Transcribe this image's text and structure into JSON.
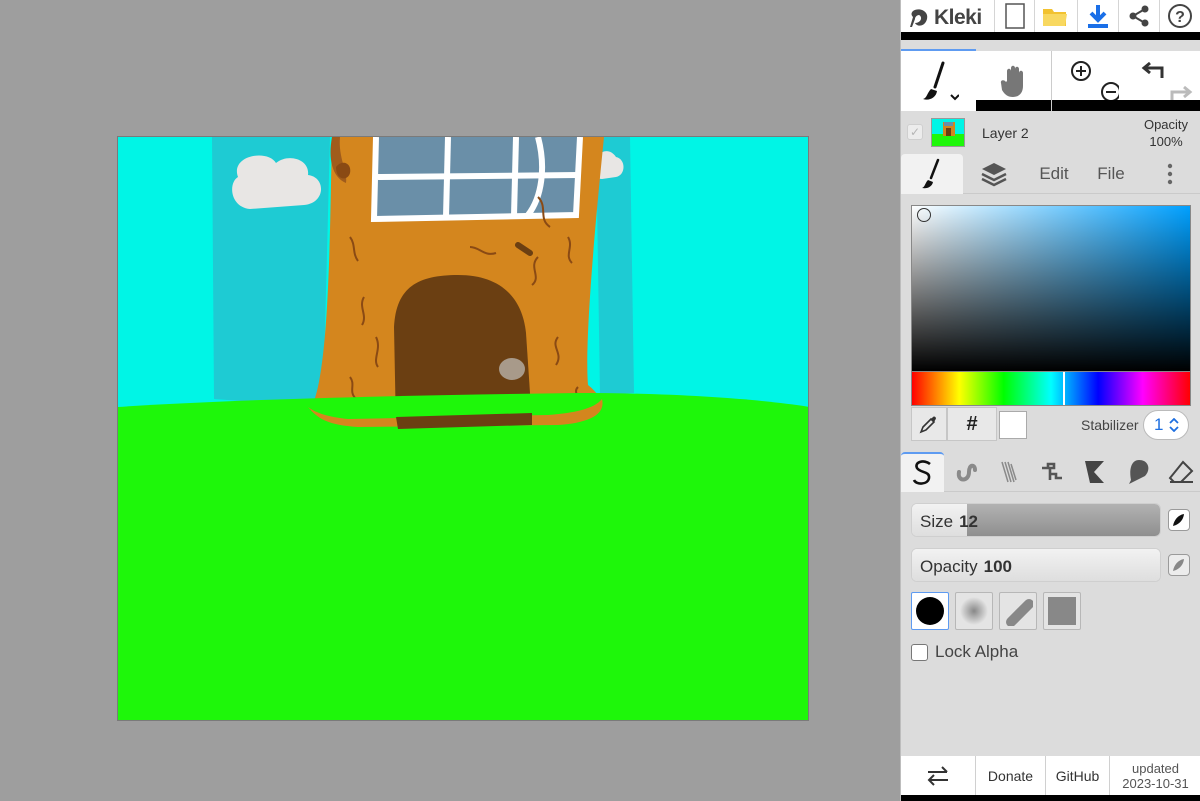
{
  "app": {
    "name": "Kleki"
  },
  "layer": {
    "name": "Layer 2",
    "opacity_label": "Opacity",
    "opacity_value": "100%"
  },
  "tabs": [
    {
      "label": "brush-icon",
      "type": "icon"
    },
    {
      "label": "layers-icon",
      "type": "icon"
    },
    {
      "label": "Edit",
      "type": "text"
    },
    {
      "label": "File",
      "type": "text"
    }
  ],
  "tab_labels": {
    "edit": "Edit",
    "file": "File"
  },
  "color": {
    "hex_button": "#",
    "current": "#ffffff",
    "stabilizer_label": "Stabilizer",
    "stabilizer_value": "1"
  },
  "brush": {
    "size_label": "Size",
    "size_value": "12",
    "size_fraction": 0.22,
    "opacity_label": "Opacity",
    "opacity_value": "100",
    "opacity_fraction": 1.0,
    "lock_alpha_label": "Lock Alpha",
    "lock_alpha_checked": false
  },
  "footer": {
    "donate": "Donate",
    "github": "GitHub",
    "updated_label": "updated",
    "updated_date": "2023-10-31"
  },
  "colors": {
    "accent": "#5e9bf1",
    "sky": "#00f5e6",
    "grass": "#1ef70a",
    "bark": "#d4861e",
    "door": "#6b3f12"
  }
}
